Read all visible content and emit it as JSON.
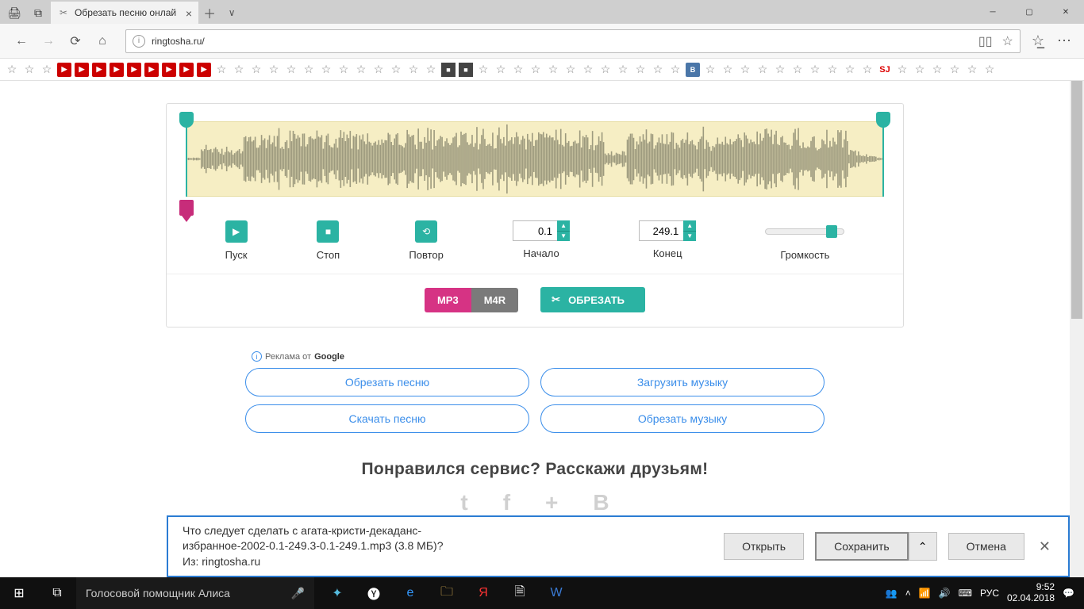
{
  "browser": {
    "tab_title": "Обрезать песню онлай",
    "url": "ringtosha.ru/"
  },
  "editor": {
    "play_label": "Пуск",
    "stop_label": "Стоп",
    "repeat_label": "Повтор",
    "start_label": "Начало",
    "end_label": "Конец",
    "volume_label": "Громкость",
    "start_value": "0.1",
    "end_value": "249.1",
    "fmt_mp3": "MP3",
    "fmt_m4r": "M4R",
    "cut_label": "ОБРЕЗАТЬ"
  },
  "ads": {
    "tag_prefix": "Реклама от",
    "tag_brand": "Google",
    "links": [
      "Обрезать песню",
      "Загрузить музыку",
      "Скачать песню",
      "Обрезать музыку"
    ]
  },
  "share": {
    "heading": "Понравился сервис? Расскажи друзьям!"
  },
  "download": {
    "line1": "Что следует сделать с агата-кристи-декаданс-",
    "line2": "избранное-2002-0.1-249.3-0.1-249.1.mp3 (3.8 МБ)?",
    "line3": "Из: ringtosha.ru",
    "open": "Открыть",
    "save": "Сохранить",
    "cancel": "Отмена"
  },
  "taskbar": {
    "search_placeholder": "Голосовой помощник Алиса",
    "lang": "РУС",
    "time": "9:52",
    "date": "02.04.2018"
  }
}
